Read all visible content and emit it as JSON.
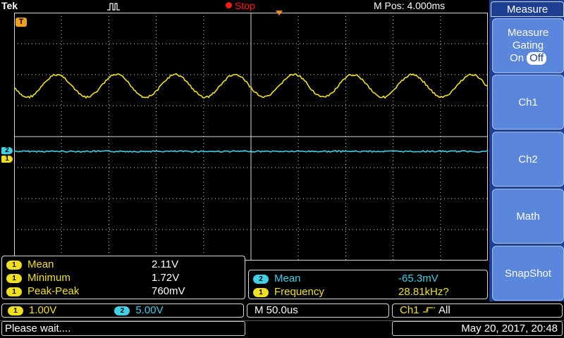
{
  "top": {
    "brand": "Tek",
    "status": "Stop",
    "horizontal_position": "M Pos: 4.000ms"
  },
  "menu": {
    "title": "Measure",
    "gating": {
      "line1": "Measure",
      "line2": "Gating",
      "on_label": "On",
      "off_label": "Off"
    },
    "buttons": [
      "Ch1",
      "Ch2",
      "Math",
      "SnapShot"
    ]
  },
  "measurements_left": [
    {
      "ch": "1",
      "name": "Mean",
      "value": "2.11V"
    },
    {
      "ch": "1",
      "name": "Minimum",
      "value": "1.72V"
    },
    {
      "ch": "1",
      "name": "Peak-Peak",
      "value": "760mV"
    }
  ],
  "measurements_right": [
    {
      "ch": "2",
      "name": "Mean",
      "value": "-65.3mV"
    },
    {
      "ch": "1",
      "name": "Frequency",
      "value": "28.81kHz?"
    }
  ],
  "channels": {
    "ch1": {
      "badge": "1",
      "scale": "1.00V",
      "color": "#f0e020"
    },
    "ch2": {
      "badge": "2",
      "scale": "5.00V",
      "color": "#40d0e8"
    }
  },
  "timebase": "M 50.0us",
  "trigger": {
    "source": "Ch1",
    "mode": "All"
  },
  "status_message": "Please wait....",
  "datetime": "May 20, 2017, 20:48",
  "trigger_marker": "T",
  "colors": {
    "menu_bg": "#1e3f92",
    "menu_button": "#5a86dc",
    "grid": "#d8d8d8"
  }
}
